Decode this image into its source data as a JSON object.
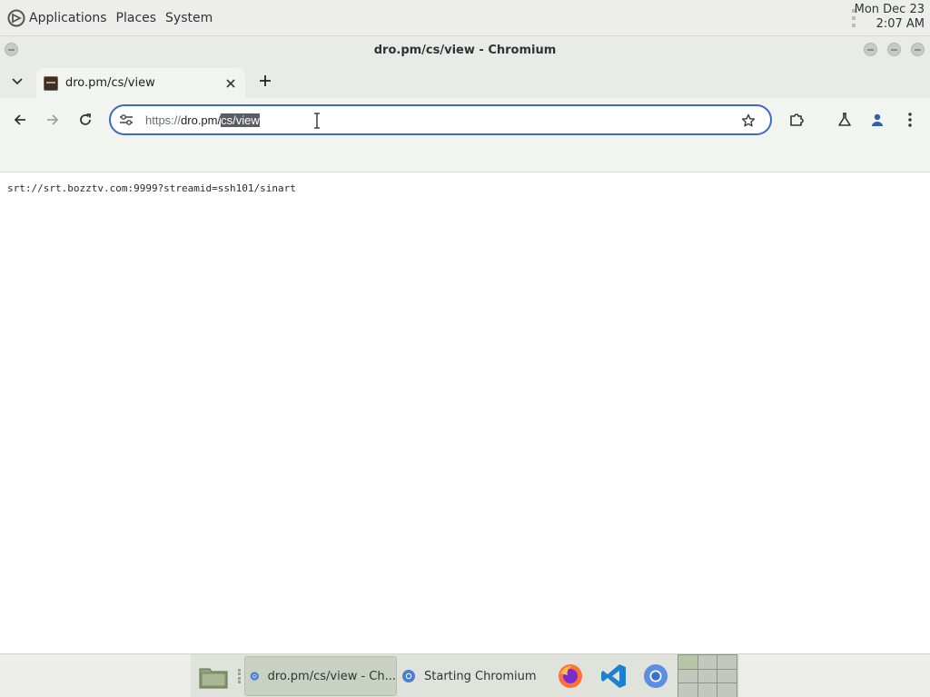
{
  "top_panel": {
    "menu": [
      "Applications",
      "Places",
      "System"
    ],
    "clock": {
      "date": "Mon Dec 23",
      "time": "2:07 AM"
    }
  },
  "window": {
    "title": "dro.pm/cs/view - Chromium"
  },
  "tabs": [
    {
      "title": "dro.pm/cs/view",
      "favicon": "site-favicon",
      "active": true
    }
  ],
  "toolbar": {
    "back_icon": "arrow-left-icon",
    "forward_icon": "arrow-right-icon",
    "reload_icon": "reload-icon",
    "extensions_icon": "puzzle-icon",
    "labs_icon": "flask-icon",
    "profile_icon": "person-icon",
    "menu_icon": "kebab-menu-icon"
  },
  "omnibox": {
    "scheme": "https://",
    "host": "dro.pm/",
    "selected_path": "cs/view",
    "accent": "#3c6ac4"
  },
  "page": {
    "text": "srt://srt.bozztv.com:9999?streamid=ssh101/sinart"
  },
  "taskbar": {
    "items": [
      {
        "label": "dro.pm/cs/view - Ch...",
        "active": true
      },
      {
        "label": "Starting Chromium",
        "active": false
      }
    ],
    "launchers": [
      "firefox-icon",
      "vscode-icon",
      "chromium-icon"
    ]
  }
}
